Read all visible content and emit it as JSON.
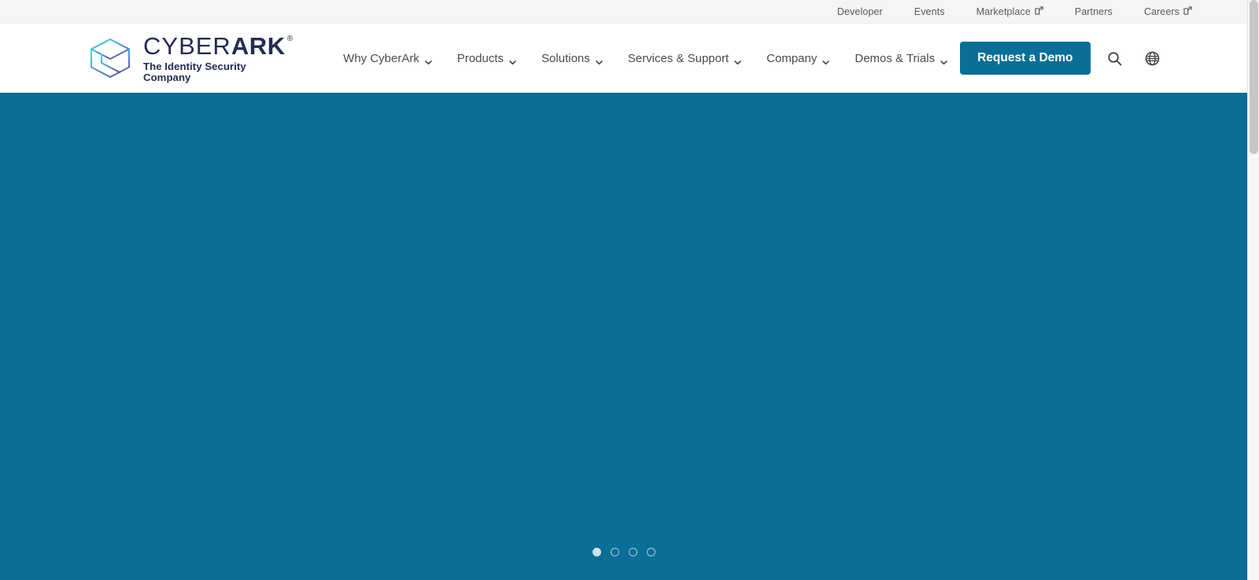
{
  "colors": {
    "hero_background": "#0a6e96",
    "utility_bar_background": "#f4f5f6",
    "nav_background": "#ffffff",
    "brand_navy": "#232c54",
    "accent_teal": "#0a6e96",
    "dot_active": "#cfe3ec",
    "dot_inactive_border": "#a8cfe0",
    "scrollbar_thumb": "#c6c6c6"
  },
  "utility_bar": {
    "links": [
      {
        "label": "Developer",
        "external": false
      },
      {
        "label": "Events",
        "external": false
      },
      {
        "label": "Marketplace",
        "external": true
      },
      {
        "label": "Partners",
        "external": false
      },
      {
        "label": "Careers",
        "external": true
      }
    ]
  },
  "logo": {
    "word_light": "CYBER",
    "word_bold": "ARK",
    "registered": "®",
    "tagline": "The Identity Security Company",
    "mark_icon": "cube-logo-icon"
  },
  "nav": {
    "items": [
      {
        "label": "Why CyberArk",
        "has_dropdown": true
      },
      {
        "label": "Products",
        "has_dropdown": true
      },
      {
        "label": "Solutions",
        "has_dropdown": true
      },
      {
        "label": "Services & Support",
        "has_dropdown": true
      },
      {
        "label": "Company",
        "has_dropdown": true
      },
      {
        "label": "Demos & Trials",
        "has_dropdown": true
      }
    ],
    "cta_label": "Request a Demo",
    "search_icon": "search-icon",
    "language_icon": "globe-icon"
  },
  "hero": {
    "carousel": {
      "slide_count": 4,
      "active_index": 0,
      "dot_labels": [
        "Slide 1",
        "Slide 2",
        "Slide 3",
        "Slide 4"
      ]
    }
  }
}
